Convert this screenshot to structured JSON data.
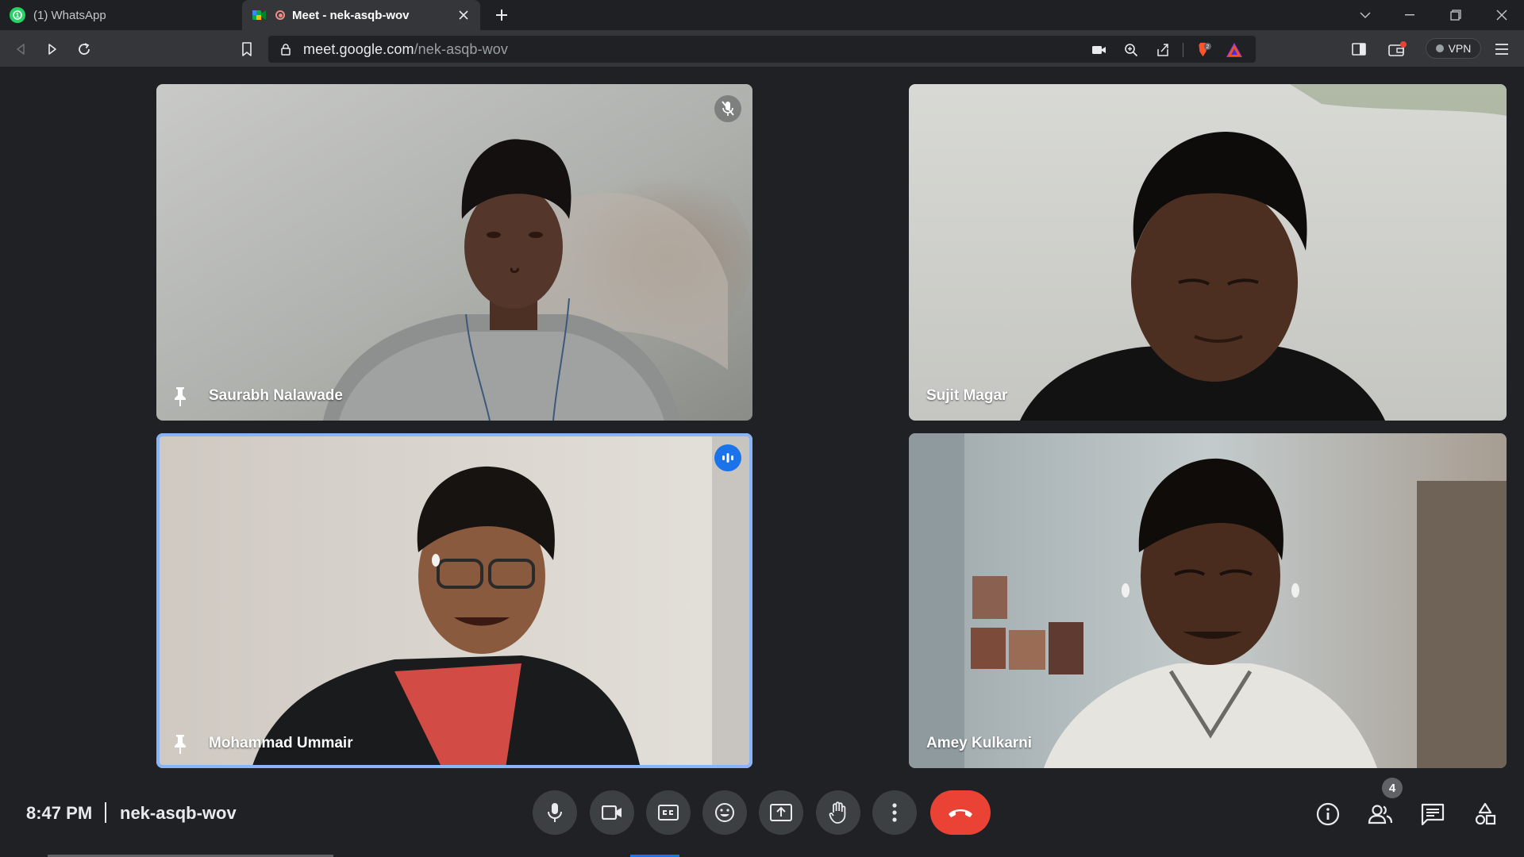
{
  "browser": {
    "tabs": [
      {
        "title": "(1) WhatsApp",
        "active": false
      },
      {
        "title": "Meet - nek-asqb-wov",
        "active": true
      }
    ],
    "url_host": "meet.google.com",
    "url_path": "/nek-asqb-wov",
    "shields_count": "2",
    "vpn_label": "VPN"
  },
  "participants": [
    {
      "name": "Saurabh Nalawade",
      "muted": true,
      "pinned_icon": true,
      "speaking": false
    },
    {
      "name": "Sujit Magar",
      "muted": false,
      "pinned_icon": false,
      "speaking": false
    },
    {
      "name": "Mohammad Ummair",
      "muted": false,
      "pinned_icon": true,
      "speaking": true
    },
    {
      "name": "Amey Kulkarni",
      "muted": false,
      "pinned_icon": false,
      "speaking": false
    }
  ],
  "meeting": {
    "time": "8:47 PM",
    "code": "nek-asqb-wov",
    "participant_count": "4"
  },
  "colors": {
    "background": "#202124",
    "control_bg": "#3c4043",
    "leave_red": "#ea4335",
    "active_speaker": "#8ab4f8",
    "speaking_badge": "#1a73e8"
  }
}
